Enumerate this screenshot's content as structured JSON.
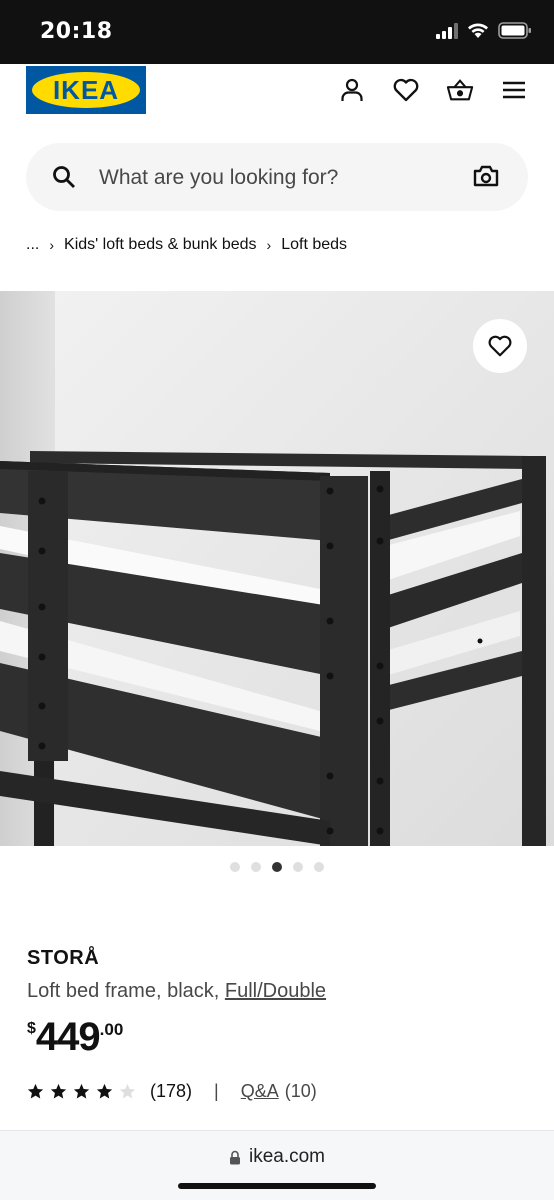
{
  "status_bar": {
    "time": "20:18"
  },
  "header": {
    "logo_text": "IKEA",
    "icons": [
      "user-icon",
      "heart-icon",
      "basket-icon",
      "menu-icon"
    ]
  },
  "search": {
    "placeholder": "What are you looking for?",
    "icons": [
      "search-icon",
      "camera-icon"
    ]
  },
  "breadcrumb": {
    "items": [
      "...",
      "Kids' loft beds & bunk beds",
      "Loft beds"
    ]
  },
  "gallery": {
    "current_index": 3,
    "total": 5
  },
  "product": {
    "name": "STORÅ",
    "description": "Loft bed frame, black, ",
    "size_link": "Full/Double",
    "price_currency": "$",
    "price_integer": "449",
    "price_decimal": ".00",
    "rating_stars": 4,
    "rating_max": 5,
    "rating_count": "(178)",
    "separator": "|",
    "qa_label": "Q&A",
    "qa_count": "(10)"
  },
  "browser": {
    "url": "ikea.com"
  },
  "colors": {
    "ikea_blue": "#0058a3",
    "ikea_yellow": "#ffdb00"
  }
}
